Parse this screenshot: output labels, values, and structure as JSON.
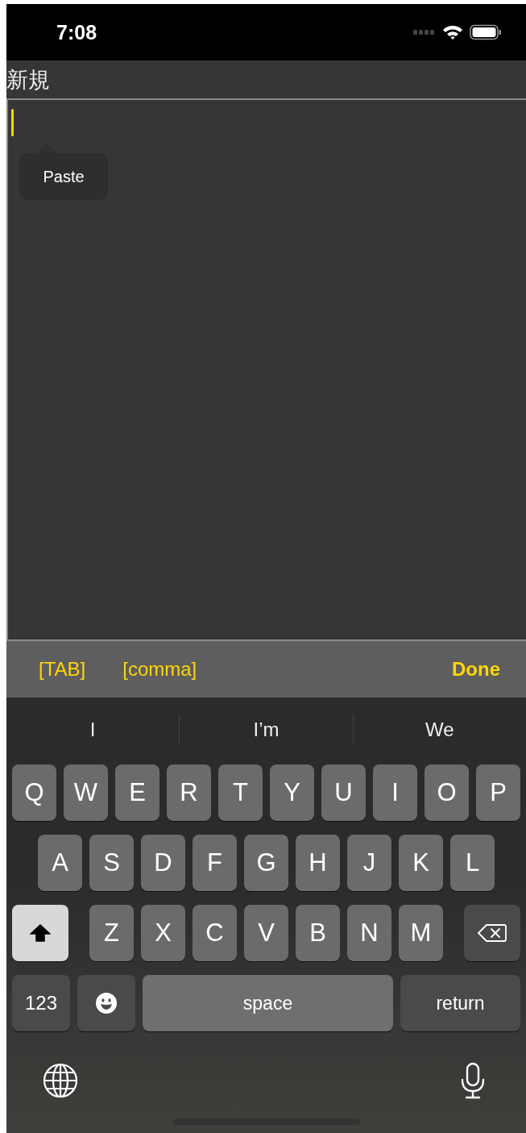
{
  "status_bar": {
    "time": "7:08"
  },
  "title": "新規",
  "editor": {
    "focused": true,
    "edit_menu": [
      "Paste"
    ]
  },
  "accessory_bar": {
    "buttons": [
      {
        "label": "[TAB]",
        "kind": "insert"
      },
      {
        "label": "[comma]",
        "kind": "insert"
      },
      {
        "label": "Done",
        "kind": "done"
      }
    ]
  },
  "suggestions": [
    "I",
    "I’m",
    "We"
  ],
  "keyboard": {
    "shift_on": true,
    "rows": [
      [
        "Q",
        "W",
        "E",
        "R",
        "T",
        "Y",
        "U",
        "I",
        "O",
        "P"
      ],
      [
        "A",
        "S",
        "D",
        "F",
        "G",
        "H",
        "J",
        "K",
        "L"
      ],
      [
        "Z",
        "X",
        "C",
        "V",
        "B",
        "N",
        "M"
      ]
    ],
    "bottom_row": [
      {
        "label": "123",
        "kind": "numbers"
      },
      {
        "kind": "emoji"
      },
      {
        "label": "space",
        "kind": "space"
      },
      {
        "label": "return",
        "kind": "return"
      }
    ]
  }
}
